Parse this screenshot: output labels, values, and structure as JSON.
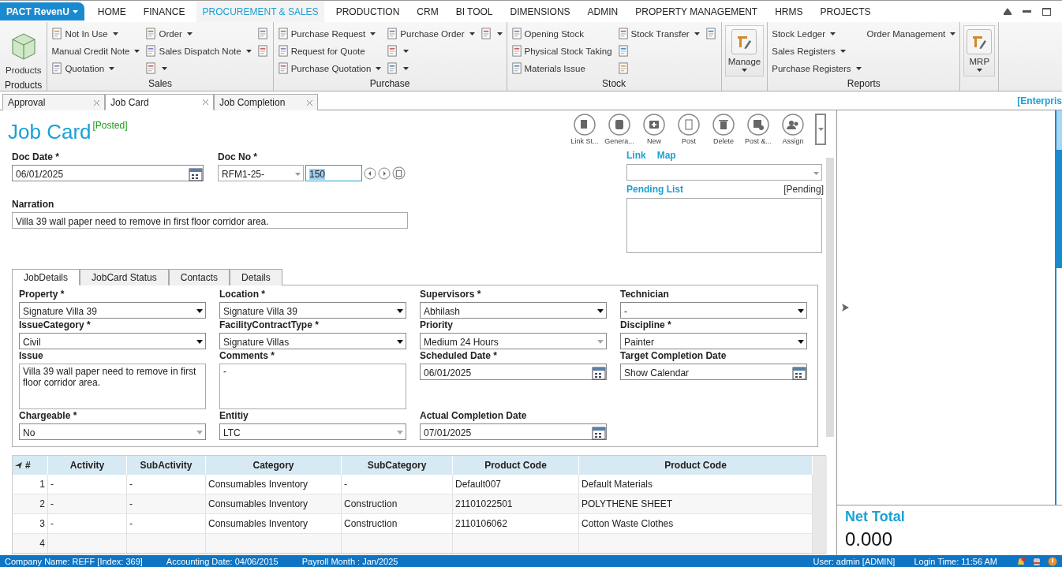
{
  "menu": {
    "app_button": "PACT RevenU",
    "tabs": [
      {
        "label": "HOME",
        "selected": false
      },
      {
        "label": "FINANCE",
        "selected": false
      },
      {
        "label": "PROCUREMENT & SALES",
        "selected": true
      },
      {
        "label": "PRODUCTION",
        "selected": false
      },
      {
        "label": "CRM",
        "selected": false
      },
      {
        "label": "BI TOOL",
        "selected": false
      },
      {
        "label": "DIMENSIONS",
        "selected": false
      },
      {
        "label": "ADMIN",
        "selected": false
      },
      {
        "label": "PROPERTY MANAGEMENT",
        "selected": false
      },
      {
        "label": "HRMS",
        "selected": false
      },
      {
        "label": "PROJECTS",
        "selected": false
      }
    ]
  },
  "ribbon": {
    "groups": [
      {
        "label": "Products",
        "kind": "large",
        "boxed": false,
        "items": [
          {
            "label": "Products",
            "dropdown": false
          }
        ]
      },
      {
        "label": "Sales",
        "kind": "columns",
        "columns": [
          [
            {
              "label": "Not In Use",
              "icon": true,
              "dropdown": true
            },
            {
              "label": "Manual Credit Note",
              "icon": false,
              "dropdown": true
            },
            {
              "label": "Quotation",
              "icon": true,
              "dropdown": true
            }
          ],
          [
            {
              "label": "Order",
              "icon": true,
              "dropdown": true
            },
            {
              "label": "Sales Dispatch Note",
              "icon": true,
              "dropdown": true
            },
            {
              "icon": true,
              "dropdown": true
            }
          ],
          [
            {
              "icon": true,
              "dropdown": false
            },
            {
              "icon": true,
              "dropdown": false
            }
          ]
        ]
      },
      {
        "label": "Purchase",
        "kind": "columns",
        "columns": [
          [
            {
              "label": "Purchase Request",
              "icon": true,
              "dropdown": true
            },
            {
              "label": "Request for Quote",
              "icon": true,
              "dropdown": false
            },
            {
              "label": "Purchase Quotation",
              "icon": true,
              "dropdown": true
            }
          ],
          [
            {
              "label": "Purchase Order",
              "icon": true,
              "dropdown": true
            },
            {
              "icon": true,
              "dropdown": true
            },
            {
              "icon": true,
              "dropdown": true
            }
          ],
          [
            {
              "icon": true,
              "dropdown": true
            }
          ]
        ]
      },
      {
        "label": "Stock",
        "kind": "columns",
        "columns": [
          [
            {
              "label": "Opening Stock",
              "icon": true,
              "dropdown": false
            },
            {
              "label": "Physical Stock Taking",
              "icon": true,
              "dropdown": false
            },
            {
              "label": "Materials Issue",
              "icon": true,
              "dropdown": false
            }
          ],
          [
            {
              "label": "Stock Transfer",
              "icon": true,
              "dropdown": true
            },
            {
              "icon": true,
              "dropdown": false
            },
            {
              "icon": true,
              "dropdown": false
            }
          ],
          [
            {
              "icon": true,
              "dropdown": false
            }
          ]
        ]
      },
      {
        "kind": "large",
        "boxed": true,
        "items": [
          {
            "label": "Manage",
            "dropdown": true
          }
        ]
      },
      {
        "label": "Reports",
        "kind": "columns",
        "columns": [
          [
            {
              "label": "Stock Ledger",
              "icon": false,
              "dropdown": true
            },
            {
              "label": "Sales Registers",
              "icon": false,
              "dropdown": true
            },
            {
              "label": "Purchase Registers",
              "icon": false,
              "dropdown": true
            }
          ],
          [
            {
              "label": "Order Management",
              "icon": false,
              "dropdown": true
            }
          ]
        ]
      },
      {
        "kind": "large",
        "boxed": true,
        "items": [
          {
            "label": "MRP",
            "dropdown": true
          }
        ]
      }
    ]
  },
  "doc_tabs": [
    {
      "label": "Approval",
      "selected": false
    },
    {
      "label": "Job Card",
      "selected": true
    },
    {
      "label": "Job Completion",
      "selected": false
    }
  ],
  "edition": "[Enterpris",
  "form": {
    "title": "Job Card",
    "status": "[Posted]",
    "actions": [
      "Link St...",
      "Genera...",
      "New",
      "Post",
      "Delete",
      "Post &...",
      "Assign"
    ],
    "doc_date": {
      "label": "Doc Date *",
      "value": "06/01/2025"
    },
    "doc_no": {
      "label": "Doc No *",
      "prefix": "RFM1-25-",
      "value": "150",
      "highlighted": true
    },
    "narration": {
      "label": "Narration",
      "value": "Villa 39 wall paper need to remove in first floor corridor area."
    },
    "links": [
      "Link",
      "Map"
    ],
    "pending": {
      "label": "Pending List",
      "status": "[Pending]"
    },
    "tabs": [
      {
        "label": "JobDetails",
        "selected": true
      },
      {
        "label": "JobCard Status",
        "selected": false
      },
      {
        "label": "Contacts",
        "selected": false
      },
      {
        "label": "Details",
        "selected": false
      }
    ],
    "fields": [
      {
        "label": "Property *",
        "kind": "select",
        "value": "Signature Villa 39",
        "disabled": false
      },
      {
        "label": "Location *",
        "kind": "select",
        "value": "Signature Villa 39",
        "disabled": false
      },
      {
        "label": "Supervisors *",
        "kind": "select",
        "value": "Abhilash",
        "disabled": false
      },
      {
        "label": "Technician",
        "kind": "select",
        "value": "-",
        "disabled": false
      },
      {
        "label": "IssueCategory *",
        "kind": "select",
        "value": "Civil",
        "disabled": false
      },
      {
        "label": "FacilityContractType *",
        "kind": "select",
        "value": "Signature Villas",
        "disabled": false
      },
      {
        "label": "Priority",
        "kind": "select",
        "value": "Medium 24 Hours",
        "disabled": true
      },
      {
        "label": "Discipline *",
        "kind": "select",
        "value": "Painter",
        "disabled": false
      },
      {
        "label": "Issue",
        "kind": "textarea",
        "value": "Villa 39 wall paper need to remove in first floor corridor area."
      },
      {
        "label": "Comments *",
        "kind": "textarea",
        "value": "-"
      },
      {
        "label": "Scheduled Date *",
        "kind": "date",
        "value": "06/01/2025"
      },
      {
        "label": "Target Completion Date",
        "kind": "date",
        "value": "Show Calendar"
      },
      {
        "label": "Chargeable *",
        "kind": "select",
        "value": "No",
        "disabled": true
      },
      {
        "label": "Entitiy",
        "kind": "select",
        "value": "LTC",
        "disabled": true
      },
      {
        "label": "Actual Completion Date",
        "kind": "date",
        "value": "07/01/2025"
      }
    ],
    "grid": {
      "columns": [
        "#",
        "Activity",
        "SubActivity",
        "Category",
        "SubCategory",
        "Product Code",
        "Product Code"
      ],
      "rows": [
        [
          "1",
          "-",
          "-",
          "Consumables Inventory",
          "-",
          "Default007",
          "Default Materials"
        ],
        [
          "2",
          "-",
          "-",
          "Consumables Inventory",
          "Construction",
          "21101022501",
          "POLYTHENE SHEET"
        ],
        [
          "3",
          "-",
          "-",
          "Consumables Inventory",
          "Construction",
          "2110106062",
          "Cotton Waste Clothes"
        ],
        [
          "4",
          "",
          "",
          "",
          "",
          "",
          ""
        ]
      ]
    }
  },
  "side": {
    "net_total_label": "Net Total",
    "net_total": "0.000"
  },
  "status_bar": {
    "left": [
      "Company Name: REFF [Index: 369]",
      "Accounting Date: 04/06/2015",
      "Payroll Month : Jan/2025"
    ],
    "right": [
      "User: admin [ADMIN]",
      "Login Time: 11:56 AM"
    ]
  }
}
